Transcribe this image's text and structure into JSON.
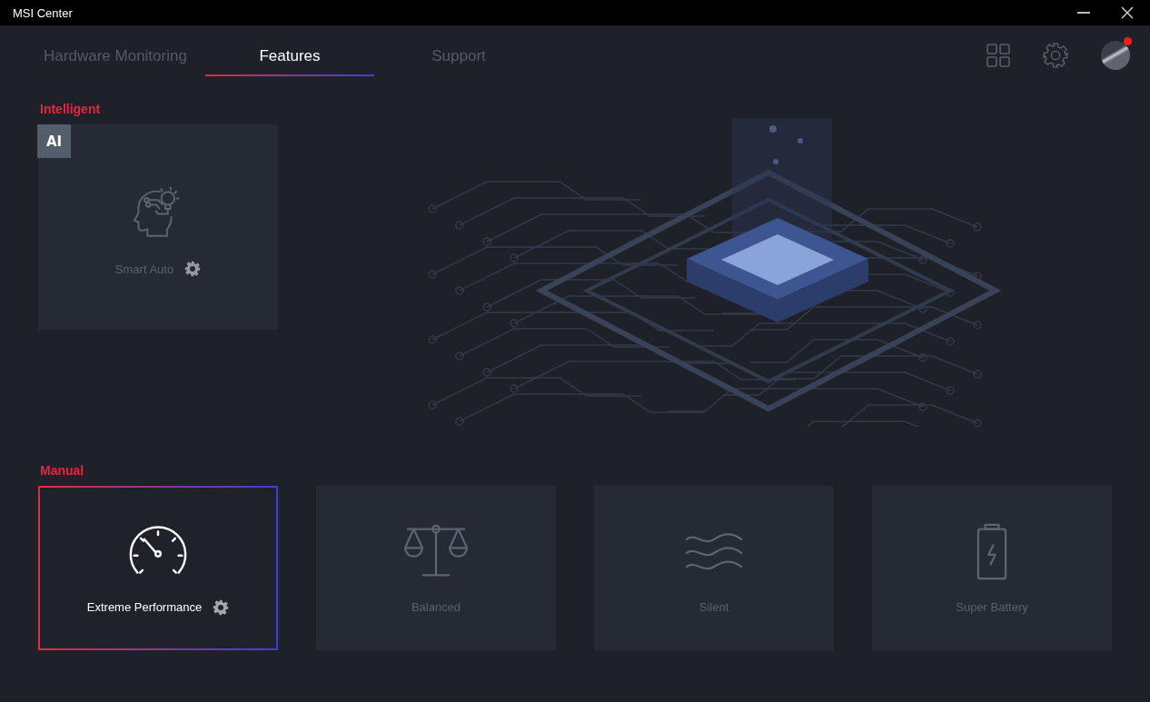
{
  "window": {
    "title": "MSI Center"
  },
  "tabs": [
    {
      "label": "Hardware Monitoring",
      "selected": false
    },
    {
      "label": "Features",
      "selected": true
    },
    {
      "label": "Support",
      "selected": false
    }
  ],
  "notification": {
    "on": true
  },
  "sections": [
    {
      "title": "Intelligent",
      "badge": "AI",
      "modes": [
        {
          "label": "Smart Auto",
          "kind": "ai",
          "selected": false,
          "settings": true
        }
      ]
    },
    {
      "title": "Manual",
      "modes": [
        {
          "label": "Extreme Performance",
          "kind": "speedometer",
          "selected": true,
          "settings": true
        },
        {
          "label": "Balanced",
          "kind": "scale",
          "selected": false,
          "settings": false
        },
        {
          "label": "Silent",
          "kind": "waves",
          "selected": false,
          "settings": false
        },
        {
          "label": "Super Battery",
          "kind": "battery",
          "selected": false,
          "settings": false
        }
      ]
    }
  ]
}
